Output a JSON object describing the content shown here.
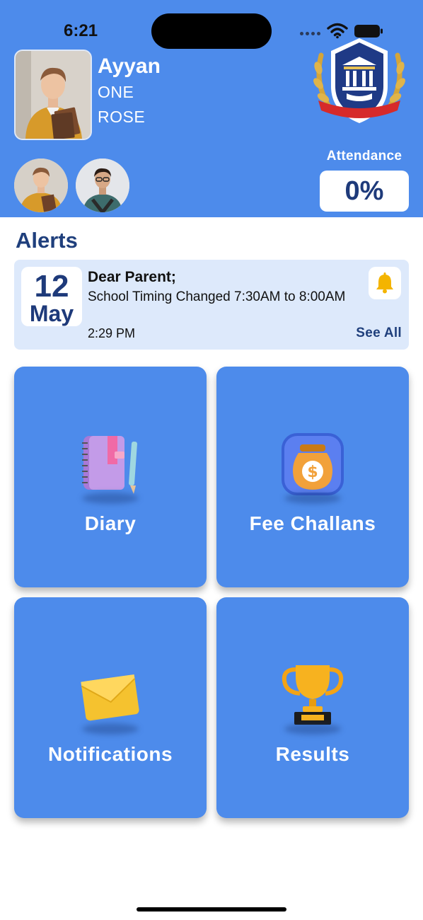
{
  "status_bar": {
    "time": "6:21",
    "icons": [
      "signal-dots-icon",
      "wifi-icon",
      "battery-icon"
    ]
  },
  "profile": {
    "name": "Ayyan",
    "class": "ONE",
    "section": "ROSE"
  },
  "attendance": {
    "label": "Attendance",
    "value": "0%"
  },
  "alerts": {
    "title": "Alerts",
    "item": {
      "day": "12",
      "month": "May",
      "heading": "Dear Parent;",
      "message": "School Timing Changed 7:30AM to 8:00AM",
      "time": "2:29 PM"
    },
    "see_all": "See All"
  },
  "tiles": [
    {
      "label": "Diary",
      "icon": "diary-icon"
    },
    {
      "label": "Fee Challans",
      "icon": "money-bag-icon"
    },
    {
      "label": "Notifications",
      "icon": "envelope-icon"
    },
    {
      "label": "Results",
      "icon": "trophy-icon"
    }
  ],
  "colors": {
    "primary": "#4d8beb",
    "heading": "#1f3f7c",
    "alert_bg": "#dde9fb"
  }
}
